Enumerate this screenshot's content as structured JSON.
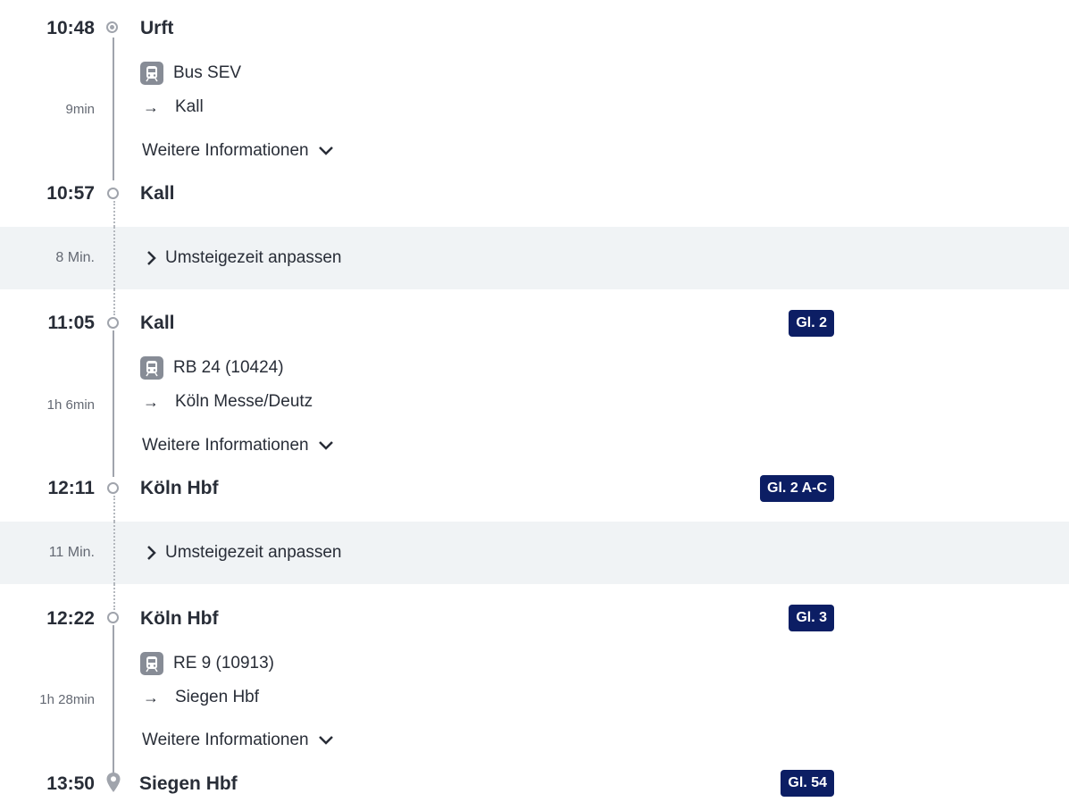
{
  "stops": [
    {
      "time": "10:48",
      "station": "Urft"
    },
    {
      "time": "10:57",
      "station": "Kall"
    },
    {
      "time": "11:05",
      "station": "Kall",
      "track": "Gl. 2"
    },
    {
      "time": "12:11",
      "station": "Köln Hbf",
      "track": "Gl. 2 A-C"
    },
    {
      "time": "12:22",
      "station": "Köln Hbf",
      "track": "Gl. 3"
    },
    {
      "time": "13:50",
      "station": "Siegen Hbf",
      "track": "Gl. 54"
    }
  ],
  "legs": [
    {
      "duration": "9min",
      "line": "Bus SEV",
      "direction": "Kall",
      "more": "Weitere Informationen",
      "icon": "train-icon"
    },
    {
      "duration": "1h 6min",
      "line": "RB 24 (10424)",
      "direction": "Köln Messe/Deutz",
      "more": "Weitere Informationen",
      "icon": "train-icon"
    },
    {
      "duration": "1h 28min",
      "line": "RE 9 (10913)",
      "direction": "Siegen Hbf",
      "more": "Weitere Informationen",
      "icon": "train-icon"
    }
  ],
  "transfers": [
    {
      "duration": "8 Min.",
      "label": "Umsteigezeit anpassen"
    },
    {
      "duration": "11 Min.",
      "label": "Umsteigezeit anpassen"
    }
  ],
  "icons": {
    "arrow": "→",
    "chevron_down": "chevron-down-icon",
    "chevron_right": "chevron-right-icon",
    "destination": "location-pin-icon"
  },
  "colors": {
    "track_badge": "#0c1e64",
    "transfer_band": "#f0f3f5",
    "timeline": "#a0a4ac"
  }
}
